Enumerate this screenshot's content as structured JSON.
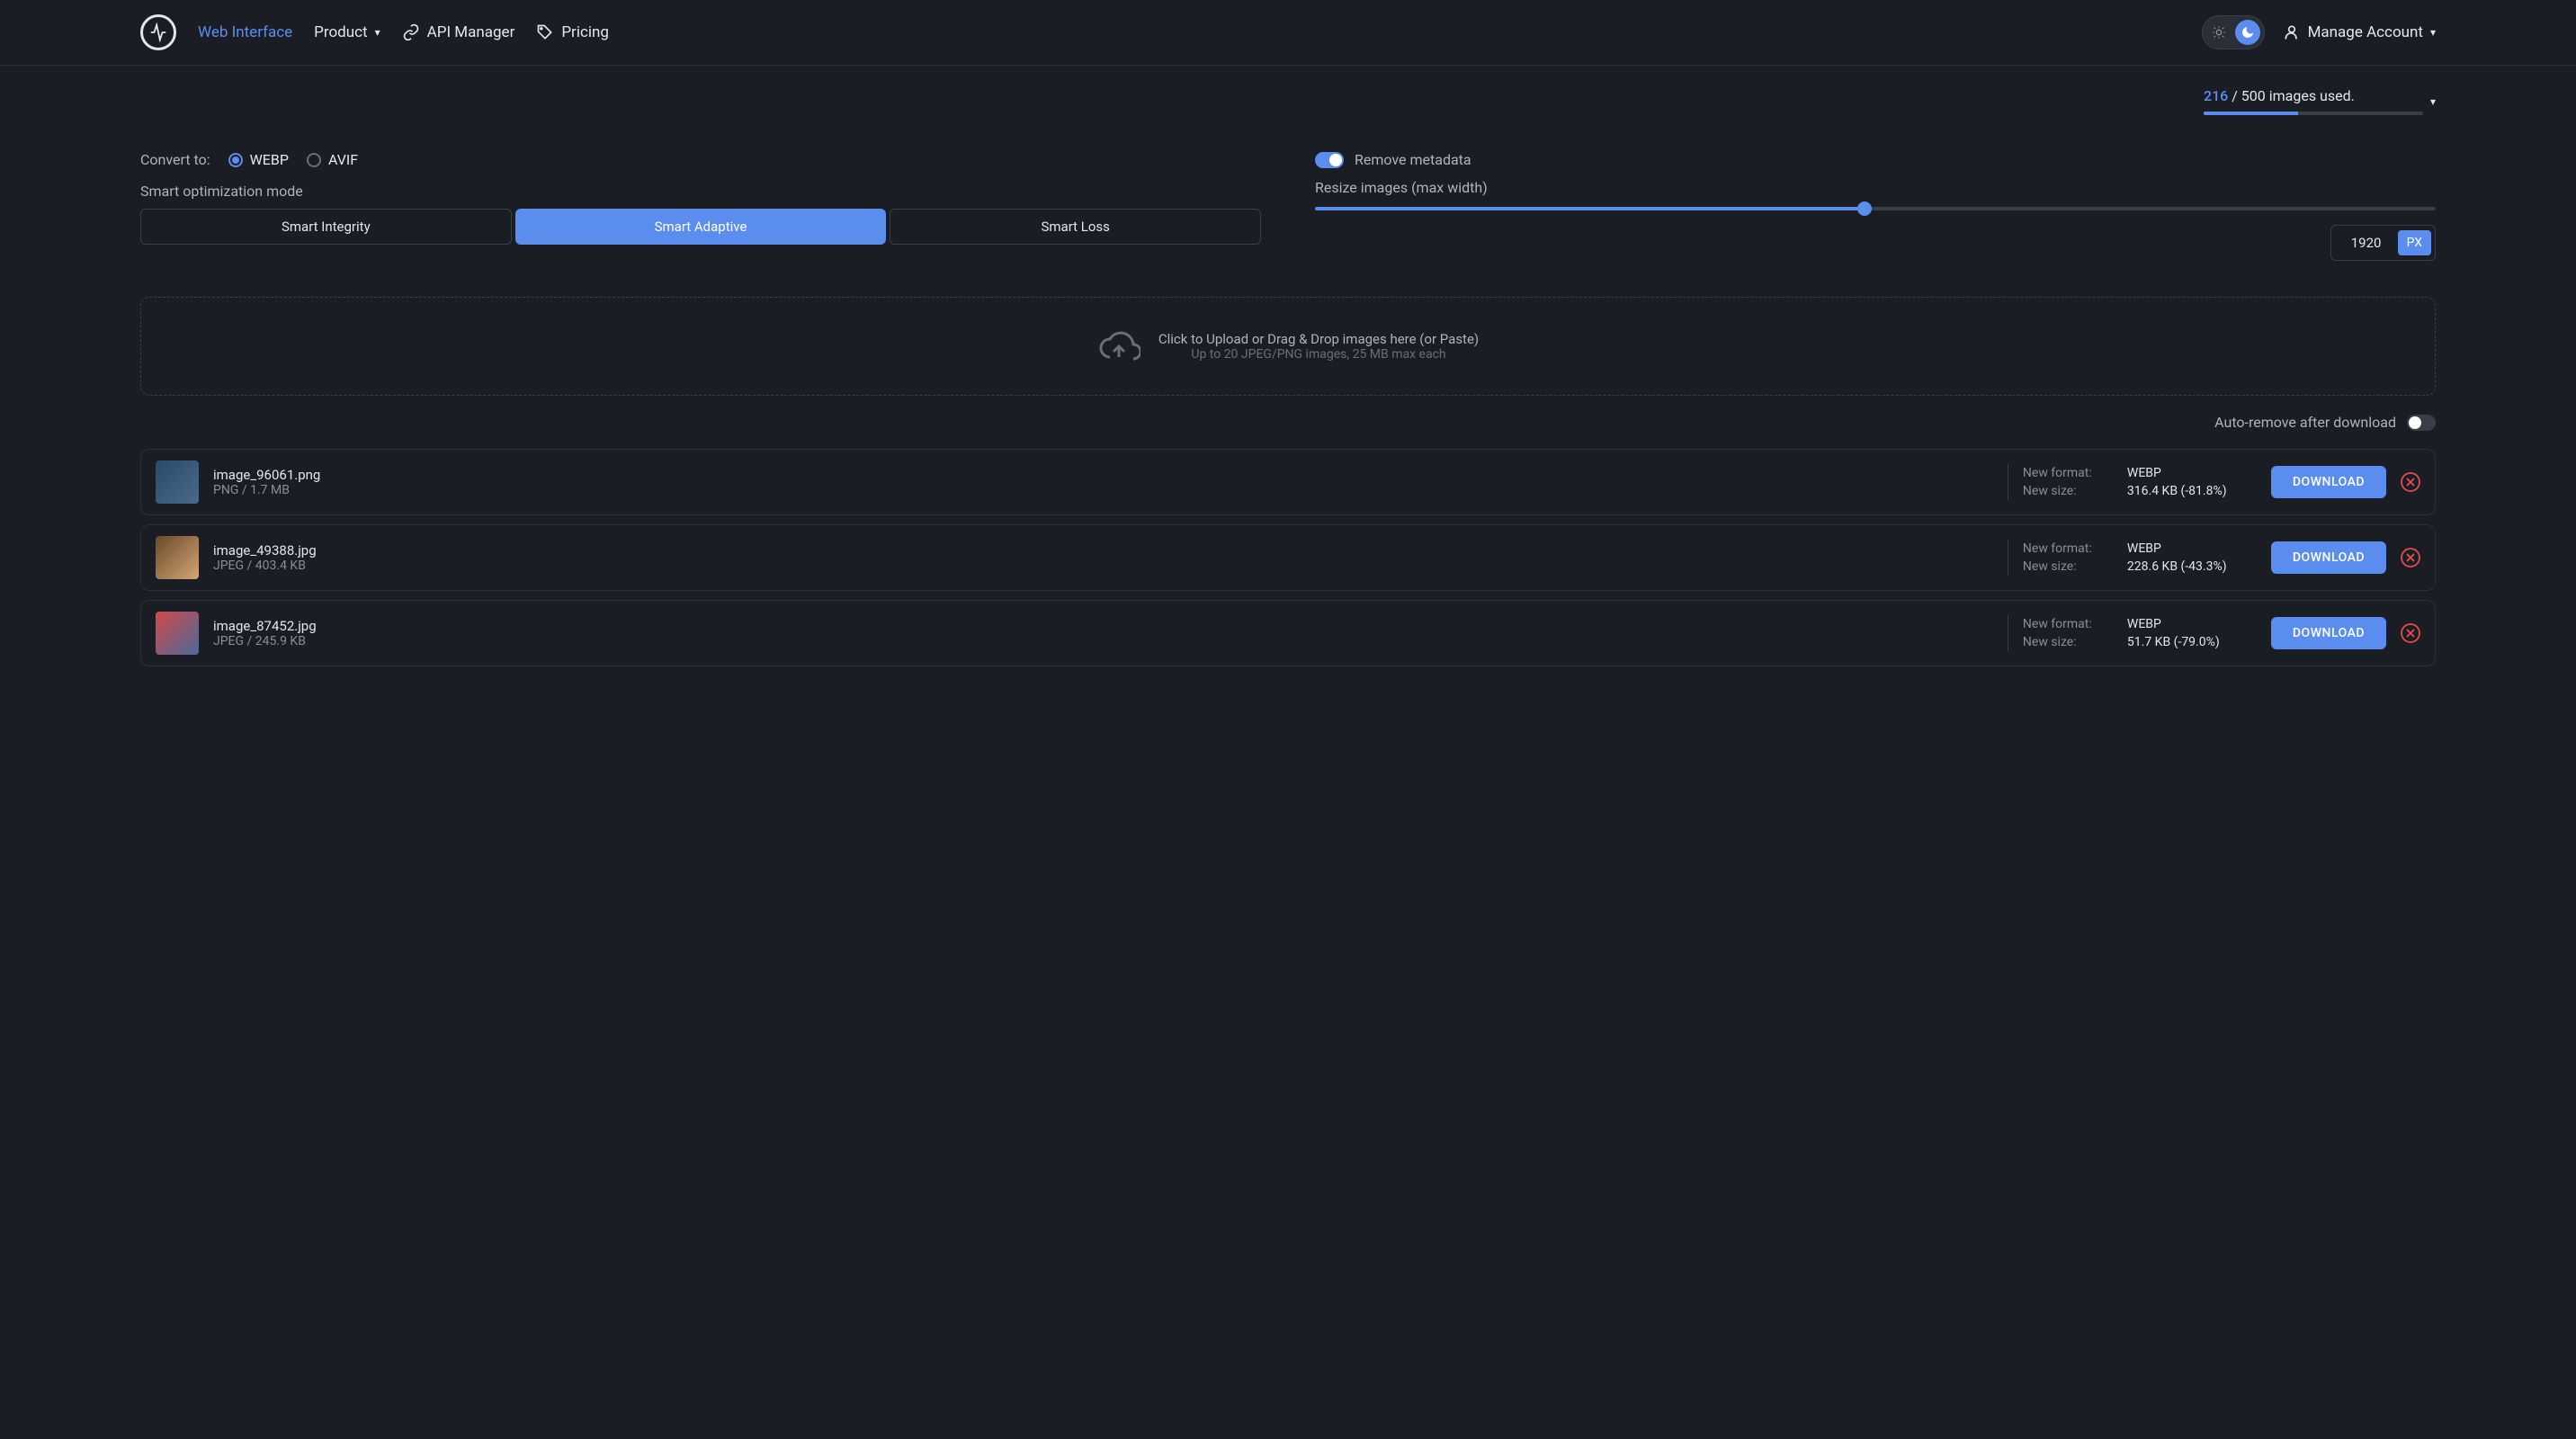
{
  "nav": {
    "web_interface": "Web Interface",
    "product": "Product",
    "api_manager": "API Manager",
    "pricing": "Pricing",
    "manage_account": "Manage Account"
  },
  "usage": {
    "used": "216",
    "separator": " / 500 images used.",
    "percent": 43.2
  },
  "convert": {
    "label": "Convert to:",
    "options": {
      "webp": "WEBP",
      "avif": "AVIF"
    },
    "selected": "webp"
  },
  "optimization": {
    "label": "Smart optimization mode",
    "modes": {
      "integrity": "Smart Integrity",
      "adaptive": "Smart Adaptive",
      "loss": "Smart Loss"
    },
    "selected": "adaptive"
  },
  "metadata": {
    "label": "Remove metadata",
    "enabled": true
  },
  "resize": {
    "label": "Resize images (max width)",
    "value": "1920",
    "unit": "PX",
    "percent": 49
  },
  "dropzone": {
    "main": "Click to Upload or Drag & Drop images here (or Paste)",
    "sub": "Up to 20 JPEG/PNG images, 25 MB max each"
  },
  "auto_remove": {
    "label": "Auto-remove after download",
    "enabled": false
  },
  "labels": {
    "new_format": "New format:",
    "new_size": "New size:",
    "download": "DOWNLOAD"
  },
  "files": [
    {
      "name": "image_96061.png",
      "meta": "PNG / 1.7 MB",
      "format": "WEBP",
      "size": "316.4 KB (-81.8%)",
      "thumb": "t1"
    },
    {
      "name": "image_49388.jpg",
      "meta": "JPEG / 403.4 KB",
      "format": "WEBP",
      "size": "228.6 KB (-43.3%)",
      "thumb": "t2"
    },
    {
      "name": "image_87452.jpg",
      "meta": "JPEG / 245.9 KB",
      "format": "WEBP",
      "size": "51.7 KB (-79.0%)",
      "thumb": "t3"
    }
  ]
}
